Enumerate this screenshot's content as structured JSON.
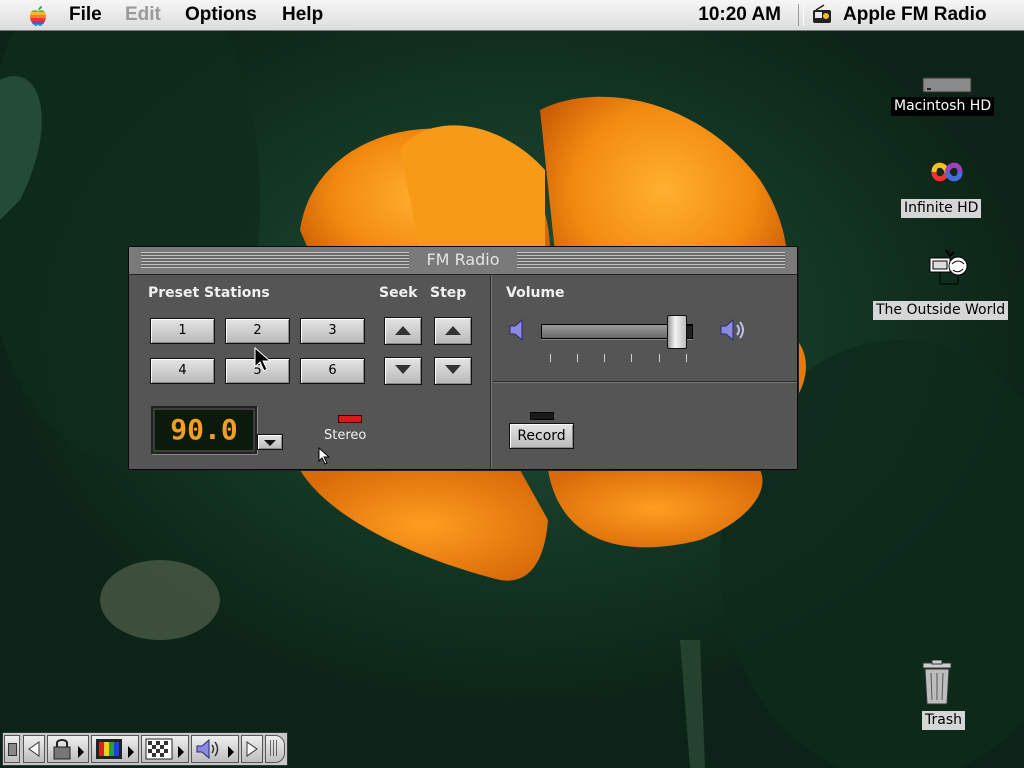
{
  "menubar": {
    "items": [
      "File",
      "Edit",
      "Options",
      "Help"
    ],
    "clock": "10:20 AM",
    "app_name": "Apple FM Radio"
  },
  "desktop_icons": [
    {
      "label": "Macintosh HD",
      "icon": "hard-disk-icon",
      "selected": true
    },
    {
      "label": "Infinite HD",
      "icon": "infinite-disk-icon",
      "selected": false
    },
    {
      "label": "The Outside World",
      "icon": "network-globe-icon",
      "selected": false
    },
    {
      "label": "Trash",
      "icon": "trash-icon",
      "selected": false
    }
  ],
  "fm_window": {
    "title": "FM Radio",
    "preset_label": "Preset Stations",
    "presets": [
      "1",
      "2",
      "3",
      "4",
      "5",
      "6"
    ],
    "seek_label": "Seek",
    "step_label": "Step",
    "frequency": "90.0",
    "stereo_label": "Stereo",
    "volume_label": "Volume",
    "volume_level": 0.9,
    "record_label": "Record",
    "colors": {
      "display_text": "#f0a020",
      "stereo_led": "#d41c1c"
    }
  },
  "control_strip": {
    "items": [
      "appletalk-lock-icon",
      "monitor-colors-icon",
      "resolution-icon",
      "sound-volume-icon"
    ]
  }
}
